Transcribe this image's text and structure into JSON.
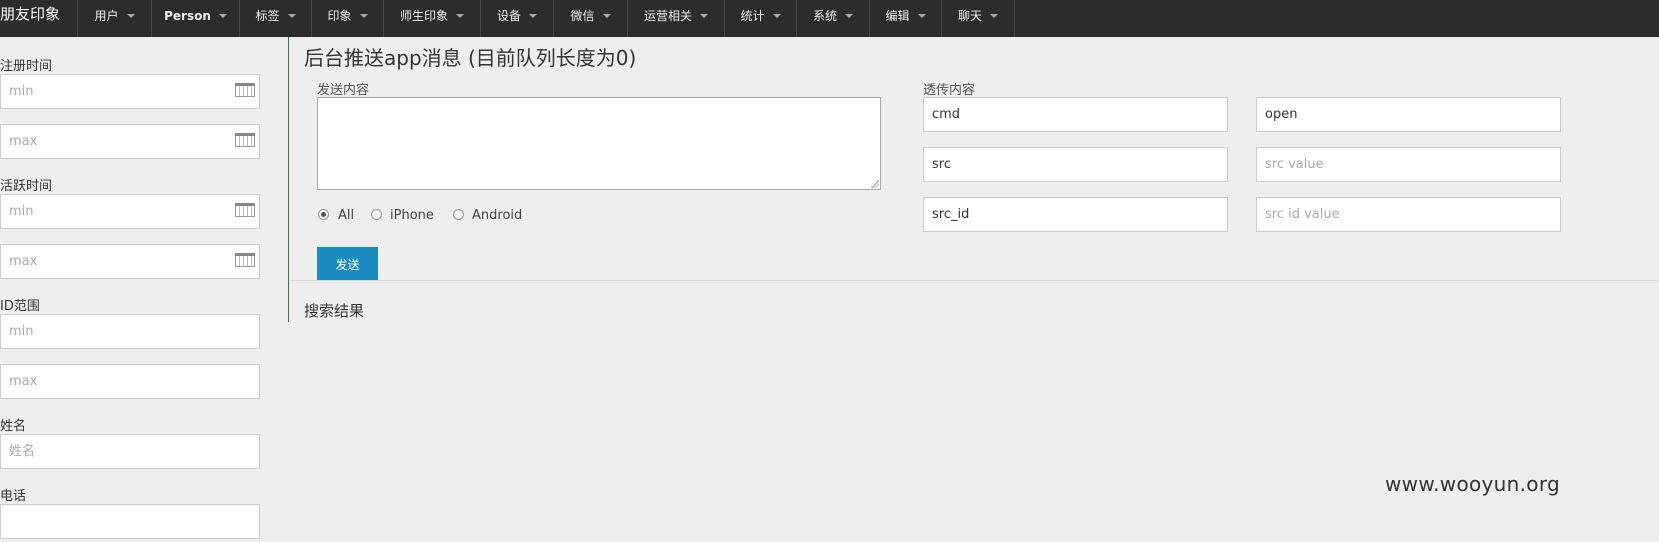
{
  "navbar": {
    "brand": "朋友印象",
    "items": [
      {
        "label": "用户"
      },
      {
        "label": "Person"
      },
      {
        "label": "标签"
      },
      {
        "label": "印象"
      },
      {
        "label": "师生印象"
      },
      {
        "label": "设备"
      },
      {
        "label": "微信"
      },
      {
        "label": "运营相关"
      },
      {
        "label": "统计"
      },
      {
        "label": "系统"
      },
      {
        "label": "编辑"
      },
      {
        "label": "聊天"
      }
    ]
  },
  "sidebar": {
    "register_time": {
      "label": "注册时间",
      "min_placeholder": "min",
      "max_placeholder": "max"
    },
    "active_time": {
      "label": "活跃时间",
      "min_placeholder": "min",
      "max_placeholder": "max"
    },
    "id_range": {
      "label": "ID范围",
      "min_placeholder": "min",
      "max_placeholder": "max"
    },
    "name": {
      "label": "姓名",
      "placeholder": "姓名"
    },
    "phone": {
      "label": "电话"
    }
  },
  "main": {
    "title": "后台推送app消息 (目前队列长度为0)",
    "content_label": "发送内容",
    "content_value": "",
    "platforms": [
      {
        "label": "All",
        "checked": true
      },
      {
        "label": "iPhone",
        "checked": false
      },
      {
        "label": "Android",
        "checked": false
      }
    ],
    "send_label": "发送",
    "passthrough_label": "透传内容",
    "passthrough_fields": [
      {
        "key": "cmd",
        "value": "open",
        "value_placeholder": ""
      },
      {
        "key": "src",
        "value": "",
        "value_placeholder": "src value"
      },
      {
        "key": "src_id",
        "value": "",
        "value_placeholder": "src id value"
      }
    ],
    "results_title": "搜索结果"
  },
  "watermark": "www.wooyun.org"
}
